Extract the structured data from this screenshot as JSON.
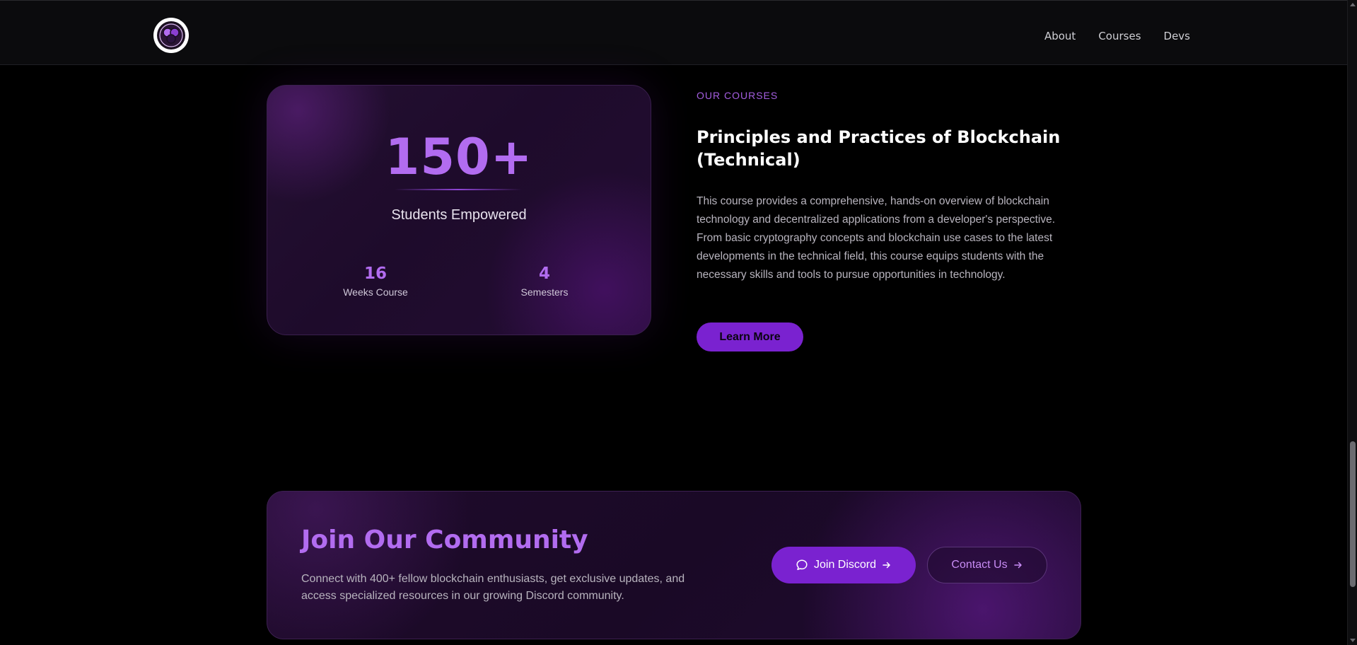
{
  "header": {
    "nav": [
      {
        "label": "About"
      },
      {
        "label": "Courses"
      },
      {
        "label": "Devs"
      }
    ],
    "logo_icon": "blockchain-logo-icon"
  },
  "stats": {
    "main_value": "150+",
    "main_label": "Students Empowered",
    "weeks_value": "16",
    "weeks_label": "Weeks Course",
    "semesters_value": "4",
    "semesters_label": "Semesters"
  },
  "course": {
    "eyebrow": "OUR COURSES",
    "title": "Principles and Practices of Blockchain (Technical)",
    "description": "This course provides a comprehensive, hands-on overview of blockchain technology and decentralized applications from a developer's perspective. From basic cryptography concepts and blockchain use cases to the latest developments in the technical field, this course equips students with the necessary skills and tools to pursue opportunities in technology.",
    "learn_more_label": "Learn More"
  },
  "community": {
    "title": "Join Our Community",
    "description": "Connect with 400+ fellow blockchain enthusiasts, get exclusive updates, and access specialized resources in our growing Discord community.",
    "discord_label": "Join Discord",
    "contact_label": "Contact Us"
  },
  "colors": {
    "accent": "#b26cf0",
    "button": "#7a22d0",
    "background": "#000000",
    "header_bg": "#0b0b0d"
  }
}
